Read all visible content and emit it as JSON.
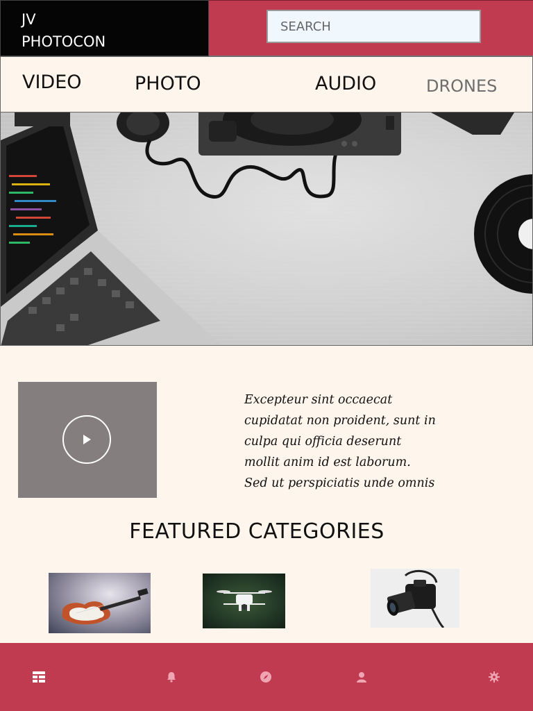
{
  "header": {
    "logo_line1": "JV",
    "logo_line2": "PHOTOCON",
    "search_placeholder": "SEARCH",
    "accent_color": "#c13b50",
    "logo_bg_color": "#050505"
  },
  "nav": {
    "items": [
      {
        "label": "VIDEO"
      },
      {
        "label": "PHOTO"
      },
      {
        "label": "AUDIO"
      },
      {
        "label": "DRONES"
      }
    ]
  },
  "hero": {
    "image": "desk-flatlay-laptop-headphones-turntable-vinyl"
  },
  "video": {
    "icon": "play-icon"
  },
  "intro": {
    "lines": [
      "Excepteur sint occaecat",
      "cupidatat non proident, sunt in",
      "culpa qui officia deserunt",
      "mollit anim id est laborum.",
      "Sed ut perspiciatis unde omnis"
    ]
  },
  "featured": {
    "title": "FEATURED CATEGORIES",
    "thumbnails": [
      "electric-guitar",
      "drone",
      "camera"
    ]
  },
  "bottom_nav": {
    "icons": [
      "list-icon",
      "bell-icon",
      "compass-icon",
      "user-icon",
      "gear-icon"
    ],
    "active": "list-icon"
  }
}
